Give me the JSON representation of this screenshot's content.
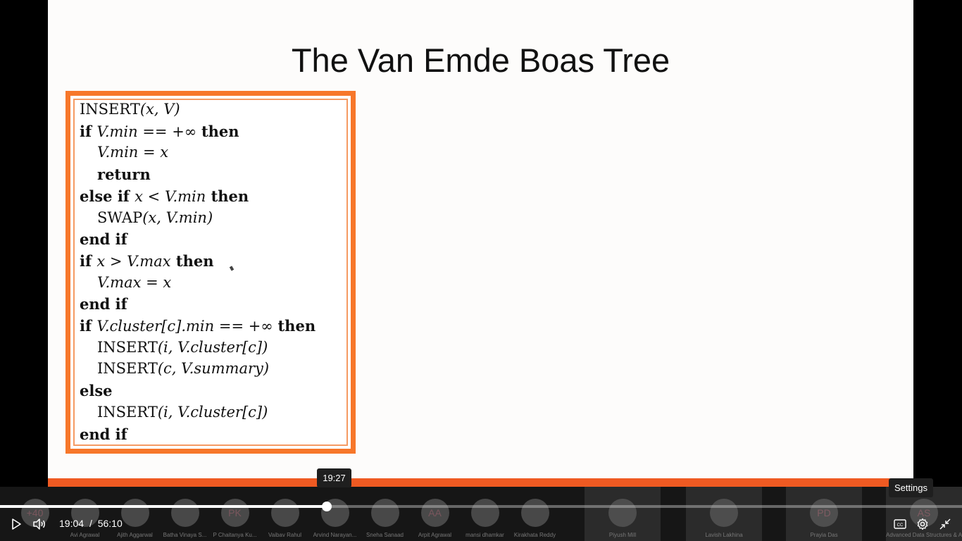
{
  "slide": {
    "title": "The Van Emde Boas Tree",
    "algorithm": [
      {
        "indent": 0,
        "parts": [
          {
            "t": "INSERT",
            "s": "sc"
          },
          {
            "t": "(x, V)",
            "s": "it"
          }
        ]
      },
      {
        "indent": 0,
        "parts": [
          {
            "t": "if ",
            "s": "kw"
          },
          {
            "t": "V.min",
            "s": "it"
          },
          {
            "t": " == +∞ ",
            "s": ""
          },
          {
            "t": "then",
            "s": "kw"
          }
        ]
      },
      {
        "indent": 1,
        "parts": [
          {
            "t": "V.min",
            "s": "it"
          },
          {
            "t": " = ",
            "s": ""
          },
          {
            "t": "x",
            "s": "it"
          }
        ]
      },
      {
        "indent": 1,
        "parts": [
          {
            "t": "return",
            "s": "kw"
          }
        ]
      },
      {
        "indent": 0,
        "parts": [
          {
            "t": "else if ",
            "s": "kw"
          },
          {
            "t": "x",
            "s": "it"
          },
          {
            "t": " < ",
            "s": ""
          },
          {
            "t": "V.min",
            "s": "it"
          },
          {
            "t": " then",
            "s": "kw"
          }
        ]
      },
      {
        "indent": 1,
        "parts": [
          {
            "t": "SWAP",
            "s": "sc"
          },
          {
            "t": "(x, V.min)",
            "s": "it"
          }
        ]
      },
      {
        "indent": 0,
        "parts": [
          {
            "t": "end if",
            "s": "kw"
          }
        ]
      },
      {
        "indent": 0,
        "parts": [
          {
            "t": "if ",
            "s": "kw"
          },
          {
            "t": "x",
            "s": "it"
          },
          {
            "t": " > ",
            "s": ""
          },
          {
            "t": "V.max",
            "s": "it"
          },
          {
            "t": " then",
            "s": "kw"
          }
        ]
      },
      {
        "indent": 1,
        "parts": [
          {
            "t": "V.max",
            "s": "it"
          },
          {
            "t": " = ",
            "s": ""
          },
          {
            "t": "x",
            "s": "it"
          }
        ]
      },
      {
        "indent": 0,
        "parts": [
          {
            "t": "end if",
            "s": "kw"
          }
        ]
      },
      {
        "indent": 0,
        "parts": [
          {
            "t": "if ",
            "s": "kw"
          },
          {
            "t": "V.cluster[c].min",
            "s": "it"
          },
          {
            "t": " == +∞ ",
            "s": ""
          },
          {
            "t": "then",
            "s": "kw"
          }
        ]
      },
      {
        "indent": 1,
        "parts": [
          {
            "t": "INSERT",
            "s": "sc"
          },
          {
            "t": "(i, V.cluster[c])",
            "s": "it"
          }
        ]
      },
      {
        "indent": 1,
        "parts": [
          {
            "t": "INSERT",
            "s": "sc"
          },
          {
            "t": "(c, V.summary)",
            "s": "it"
          }
        ]
      },
      {
        "indent": 0,
        "parts": [
          {
            "t": "else",
            "s": "kw"
          }
        ]
      },
      {
        "indent": 1,
        "parts": [
          {
            "t": "INSERT",
            "s": "sc"
          },
          {
            "t": "(i, V.cluster[c])",
            "s": "it"
          }
        ]
      },
      {
        "indent": 0,
        "parts": [
          {
            "t": "end if",
            "s": "kw"
          }
        ]
      }
    ]
  },
  "participants": [
    {
      "initials": "+40",
      "name": ""
    },
    {
      "initials": "",
      "name": "Avi Agrawal"
    },
    {
      "initials": "",
      "name": "Ajith Aggarwal"
    },
    {
      "initials": "",
      "name": "Batha Vinaya S..."
    },
    {
      "initials": "PK",
      "name": "P Chaitanya Ku..."
    },
    {
      "initials": "",
      "name": "Vaibav Rahul"
    },
    {
      "initials": "",
      "name": "Arvind Narayan..."
    },
    {
      "initials": "",
      "name": "Sneha Sanaad"
    },
    {
      "initials": "AA",
      "name": "Arpit Agrawal"
    },
    {
      "initials": "",
      "name": "mansi dhamkar"
    },
    {
      "initials": "",
      "name": "Kirakhata Reddy"
    },
    {
      "initials": "",
      "name": "Piyush Mill"
    },
    {
      "initials": "",
      "name": "Lavish Lakhina"
    },
    {
      "initials": "PD",
      "name": "Prayia Das"
    },
    {
      "initials": "AS",
      "name": "Advanced Data Structures & Algori..."
    }
  ],
  "player": {
    "current_time": "19:04",
    "separator": "/",
    "duration": "56:10",
    "progress_fraction": 0.3394,
    "hover_time": "19:27",
    "settings_tooltip": "Settings"
  }
}
